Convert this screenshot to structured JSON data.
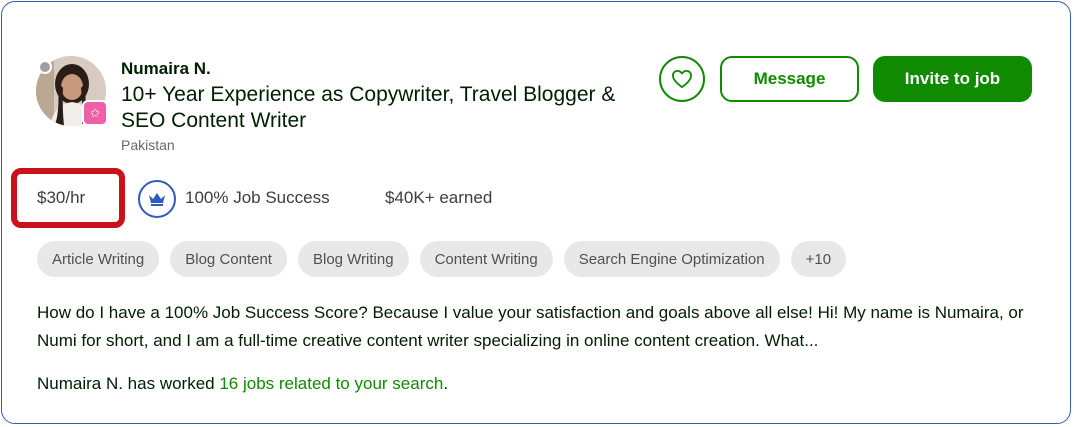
{
  "freelancer": {
    "name": "Numaira N.",
    "title": "10+ Year Experience as Copywriter, Travel Blogger & SEO Content Writer",
    "country": "Pakistan",
    "rate": "$30/hr",
    "job_success": "100% Job Success",
    "earned": "$40K+ earned",
    "description": "How do I have a 100% Job Success Score? Because I value your satisfaction and goals above all else! Hi! My name is Numaira, or Numi for short, and I am a full-time creative content writer specializing in online content creation. What..."
  },
  "actions": {
    "save_icon": "heart-icon",
    "message_label": "Message",
    "invite_label": "Invite to job"
  },
  "skills": [
    "Article Writing",
    "Blog Content",
    "Blog Writing",
    "Content Writing",
    "Search Engine Optimization",
    "+10"
  ],
  "worked": {
    "prefix": "Numaira N. has worked ",
    "link": "16 jobs related to your search",
    "suffix": "."
  },
  "colors": {
    "brand_green": "#108a00",
    "highlight_red": "#c9121c",
    "badge_pink": "#f05fa5",
    "crown_blue": "#2e5bbd"
  }
}
